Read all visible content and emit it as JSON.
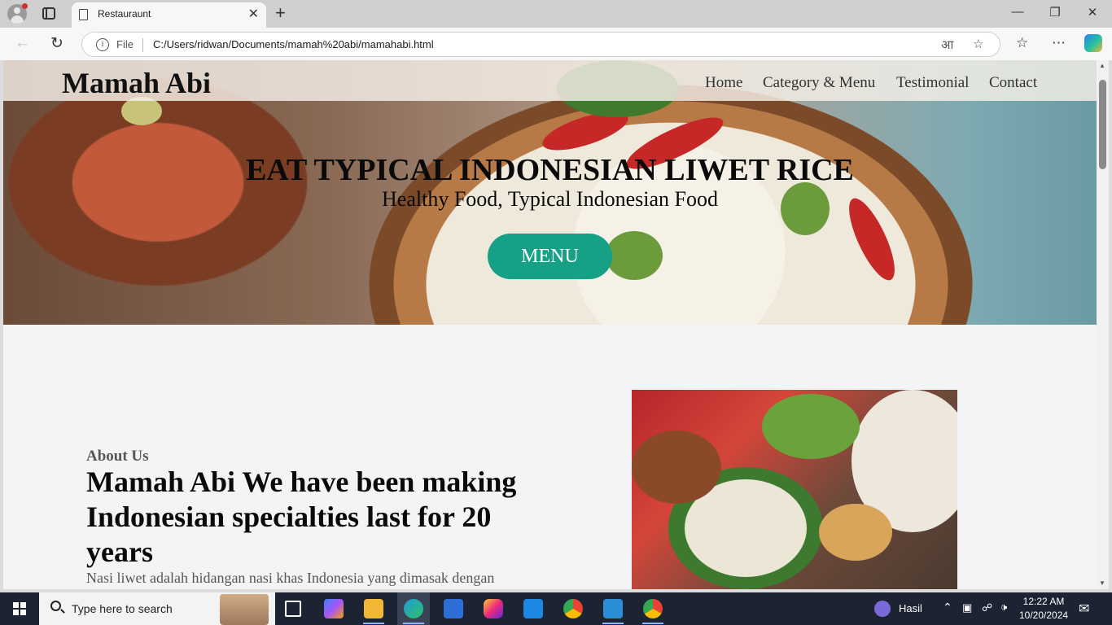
{
  "browser": {
    "tab_title": "Restauraunt",
    "file_label": "File",
    "url": "C:/Users/ridwan/Documents/mamah%20abi/mamahabi.html",
    "new_tab_symbol": "+",
    "tab_close_symbol": "✕",
    "icons": [
      "profile-icon",
      "tab-actions-icon",
      "back-icon",
      "refresh-icon",
      "info-icon",
      "read-aloud-icon",
      "favorite-star-icon",
      "favorites-icon",
      "more-icon",
      "copilot-icon"
    ]
  },
  "page": {
    "brand": "Mamah Abi",
    "nav": [
      "Home",
      "Category & Menu",
      "Testimonial",
      "Contact"
    ],
    "hero": {
      "title": "EAT TYPICAL INDONESIAN LIWET RICE",
      "subtitle": "Healthy Food, Typical Indonesian Food",
      "button": "MENU"
    },
    "about": {
      "kicker": "About Us",
      "title": "Mamah Abi We have been making Indonesian specialties last for 20 years",
      "text": "Nasi liwet adalah hidangan nasi khas Indonesia yang dimasak dengan"
    },
    "colors": {
      "accent": "#16a085"
    }
  },
  "taskbar": {
    "search_placeholder": "Type here to search",
    "weather": "Hasil",
    "time": "12:22 AM",
    "date": "10/20/2024"
  }
}
